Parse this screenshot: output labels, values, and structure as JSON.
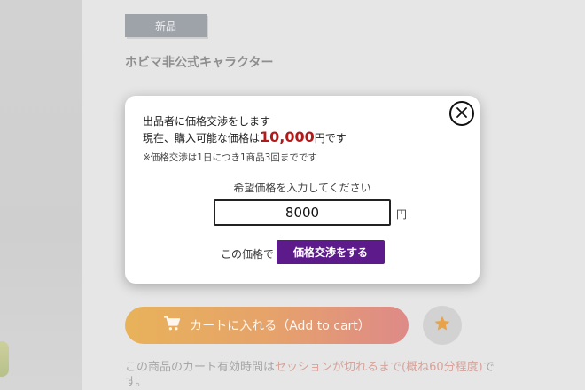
{
  "product": {
    "badge": "新品",
    "name": "ホビマ非公式キャラクター"
  },
  "cart": {
    "add_label": "カートに入れる（Add to cart）",
    "note_prefix": "この商品のカート有効時間は",
    "note_highlight": "セッションが切れるまで(概ね60分程度)",
    "note_suffix": "です。"
  },
  "modal": {
    "line1": "出品者に価格交渉をします",
    "line2_prefix": "現在、購入可能な価格は",
    "current_price": "10,000",
    "line2_suffix": "円です",
    "note": "※価格交渉は1日につき1商品3回までです",
    "input_label": "希望価格を入力してください",
    "input_value": "8000",
    "unit": "円",
    "submit_prefix": "この価格で",
    "submit_label": "価格交渉をする"
  },
  "icons": {
    "close": "close-icon",
    "cart": "cart-icon",
    "favorite": "star-icon"
  },
  "colors": {
    "price_accent": "#b21a1a",
    "submit_button": "#5c1a8a",
    "cart_gradient_start": "#e8b25a",
    "cart_gradient_end": "#de8a88",
    "favorite_star": "#e8a24a"
  }
}
